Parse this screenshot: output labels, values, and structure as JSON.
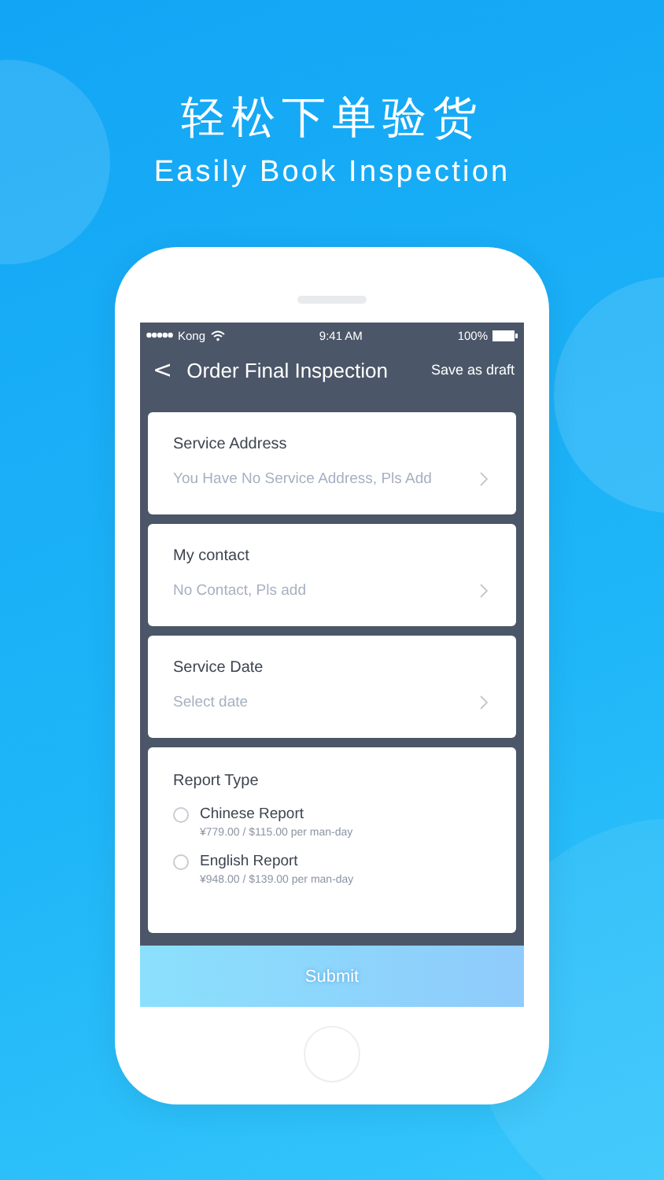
{
  "headline": "轻松下单验货",
  "subheadline": "Easily Book Inspection",
  "status_bar": {
    "carrier": "Kong",
    "time": "9:41 AM",
    "battery": "100%"
  },
  "nav": {
    "back": "<",
    "title": "Order Final Inspection",
    "action": "Save as draft"
  },
  "fields": [
    {
      "label": "Service Address",
      "placeholder": "You Have No Service Address, Pls Add"
    },
    {
      "label": "My contact",
      "placeholder": "No Contact, Pls add"
    },
    {
      "label": "Service Date",
      "placeholder": "Select date"
    }
  ],
  "report_type": {
    "label": "Report Type",
    "options": [
      {
        "name": "Chinese Report",
        "price": "¥779.00 / $115.00 per man-day",
        "selected": false
      },
      {
        "name": "English Report",
        "price": "¥948.00 / $139.00 per man-day",
        "selected": false
      }
    ]
  },
  "submit": {
    "label": "Submit",
    "disabled": true
  }
}
